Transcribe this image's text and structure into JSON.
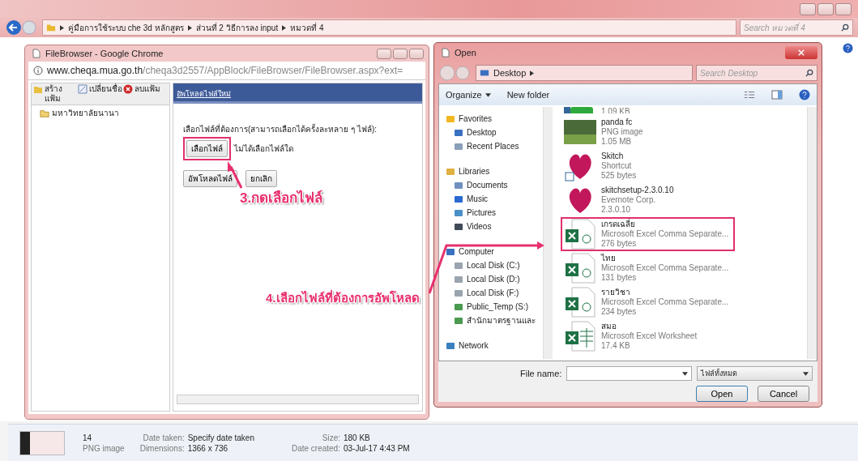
{
  "explorer": {
    "breadcrumb": [
      "คู่มือการใช้ระบบ che 3d หลักสูตร",
      "ส่วนที่ 2 วิธีการลง input",
      "หมวดที่ 4"
    ],
    "search_placeholder": "Search หมวดที่ 4"
  },
  "browser": {
    "title": "FileBrowser - Google Chrome",
    "url_host": "www.cheqa.mua.go.th",
    "url_path": "/cheqa3d2557/AppBlock/FileBrowser/FileBrowser.aspx?ext=",
    "toolbar": [
      {
        "label": "สร้างแฟ้ม",
        "kind": "new"
      },
      {
        "label": "เปลี่ยนชื่อ",
        "kind": "rename"
      },
      {
        "label": "ลบแฟ้ม",
        "kind": "delete"
      }
    ],
    "tree": [
      {
        "label": "มหาวิทยาลัยนานา"
      }
    ],
    "panel_title": "อัพโหลดไฟล์ใหม่",
    "prompt": "เลือกไฟล์ที่ต้องการ(สามารถเลือกได้ครั้งละหลาย ๆ ไฟล์):",
    "choose_button": {
      "label": "เลือกไฟล์",
      "highlighted": true
    },
    "no_file": "ไม่ได้เลือกไฟล์ใด",
    "buttons": [
      "อัพโหลดไฟล์",
      "ยกเลิก"
    ]
  },
  "dialog": {
    "title": "Open",
    "location": "Desktop",
    "search_placeholder": "Search Desktop",
    "organize": "Organize",
    "new_folder": "New folder",
    "nav": [
      {
        "label": "Favorites",
        "kind": "star",
        "children": [
          {
            "label": "Desktop",
            "kind": "monitor"
          },
          {
            "label": "Recent Places",
            "kind": "recent"
          }
        ]
      },
      {
        "label": "Libraries",
        "kind": "library",
        "children": [
          {
            "label": "Documents",
            "kind": "document"
          },
          {
            "label": "Music",
            "kind": "music"
          },
          {
            "label": "Pictures",
            "kind": "picture"
          },
          {
            "label": "Videos",
            "kind": "video"
          }
        ]
      },
      {
        "label": "Computer",
        "kind": "computer",
        "children": [
          {
            "label": "Local Disk (C:)",
            "kind": "disk"
          },
          {
            "label": "Local Disk (D:)",
            "kind": "disk"
          },
          {
            "label": "Local Disk (F:)",
            "kind": "disk"
          },
          {
            "label": "Public_Temp (S:)",
            "kind": "netdrive"
          },
          {
            "label": "สำนักมาตรฐานและ",
            "kind": "netdrive"
          }
        ]
      },
      {
        "label": "Network",
        "kind": "network"
      }
    ],
    "files": [
      {
        "kind": "partial",
        "size": "1.09 KB",
        "highlighted": false
      },
      {
        "kind": "image",
        "name": "panda fc",
        "type": "PNG image",
        "size": "1.05 MB",
        "highlighted": false
      },
      {
        "kind": "shortcut",
        "name": "Skitch",
        "type": "Shortcut",
        "size": "525 bytes",
        "highlighted": false
      },
      {
        "kind": "installer",
        "name": "skitchsetup-2.3.0.10",
        "type": "Evernote Corp.",
        "size": "2.3.0.10",
        "highlighted": false
      },
      {
        "kind": "csv",
        "name": "เกรดเฉลี่ย",
        "type": "Microsoft Excel Comma Separate...",
        "size": "276 bytes",
        "highlighted": true
      },
      {
        "kind": "csv",
        "name": "ไทย",
        "type": "Microsoft Excel Comma Separate...",
        "size": "131 bytes",
        "highlighted": false
      },
      {
        "kind": "csv",
        "name": "รายวิชา",
        "type": "Microsoft Excel Comma Separate...",
        "size": "234 bytes",
        "highlighted": false
      },
      {
        "kind": "xlsx",
        "name": "สมอ",
        "type": "Microsoft Excel Worksheet",
        "size": "17.4 KB",
        "highlighted": false
      }
    ],
    "file_name_label": "File name:",
    "file_type": "ไฟล์ทั้งหมด",
    "buttons": [
      "Open",
      "Cancel"
    ]
  },
  "annotations": [
    {
      "text": "3.กดเลือกไฟล์"
    },
    {
      "text": "4.เลือกไฟล์ที่ต้องการอัพโหลด"
    }
  ],
  "details": {
    "name": "14",
    "type": "PNG image",
    "fields": [
      {
        "label": "Date taken:",
        "value": "Specify date taken"
      },
      {
        "label": "Size:",
        "value": "180 KB"
      },
      {
        "label": "Dimensions:",
        "value": "1366 x 736"
      },
      {
        "label": "Date created:",
        "value": "03-Jul-17 4:43 PM"
      }
    ]
  }
}
